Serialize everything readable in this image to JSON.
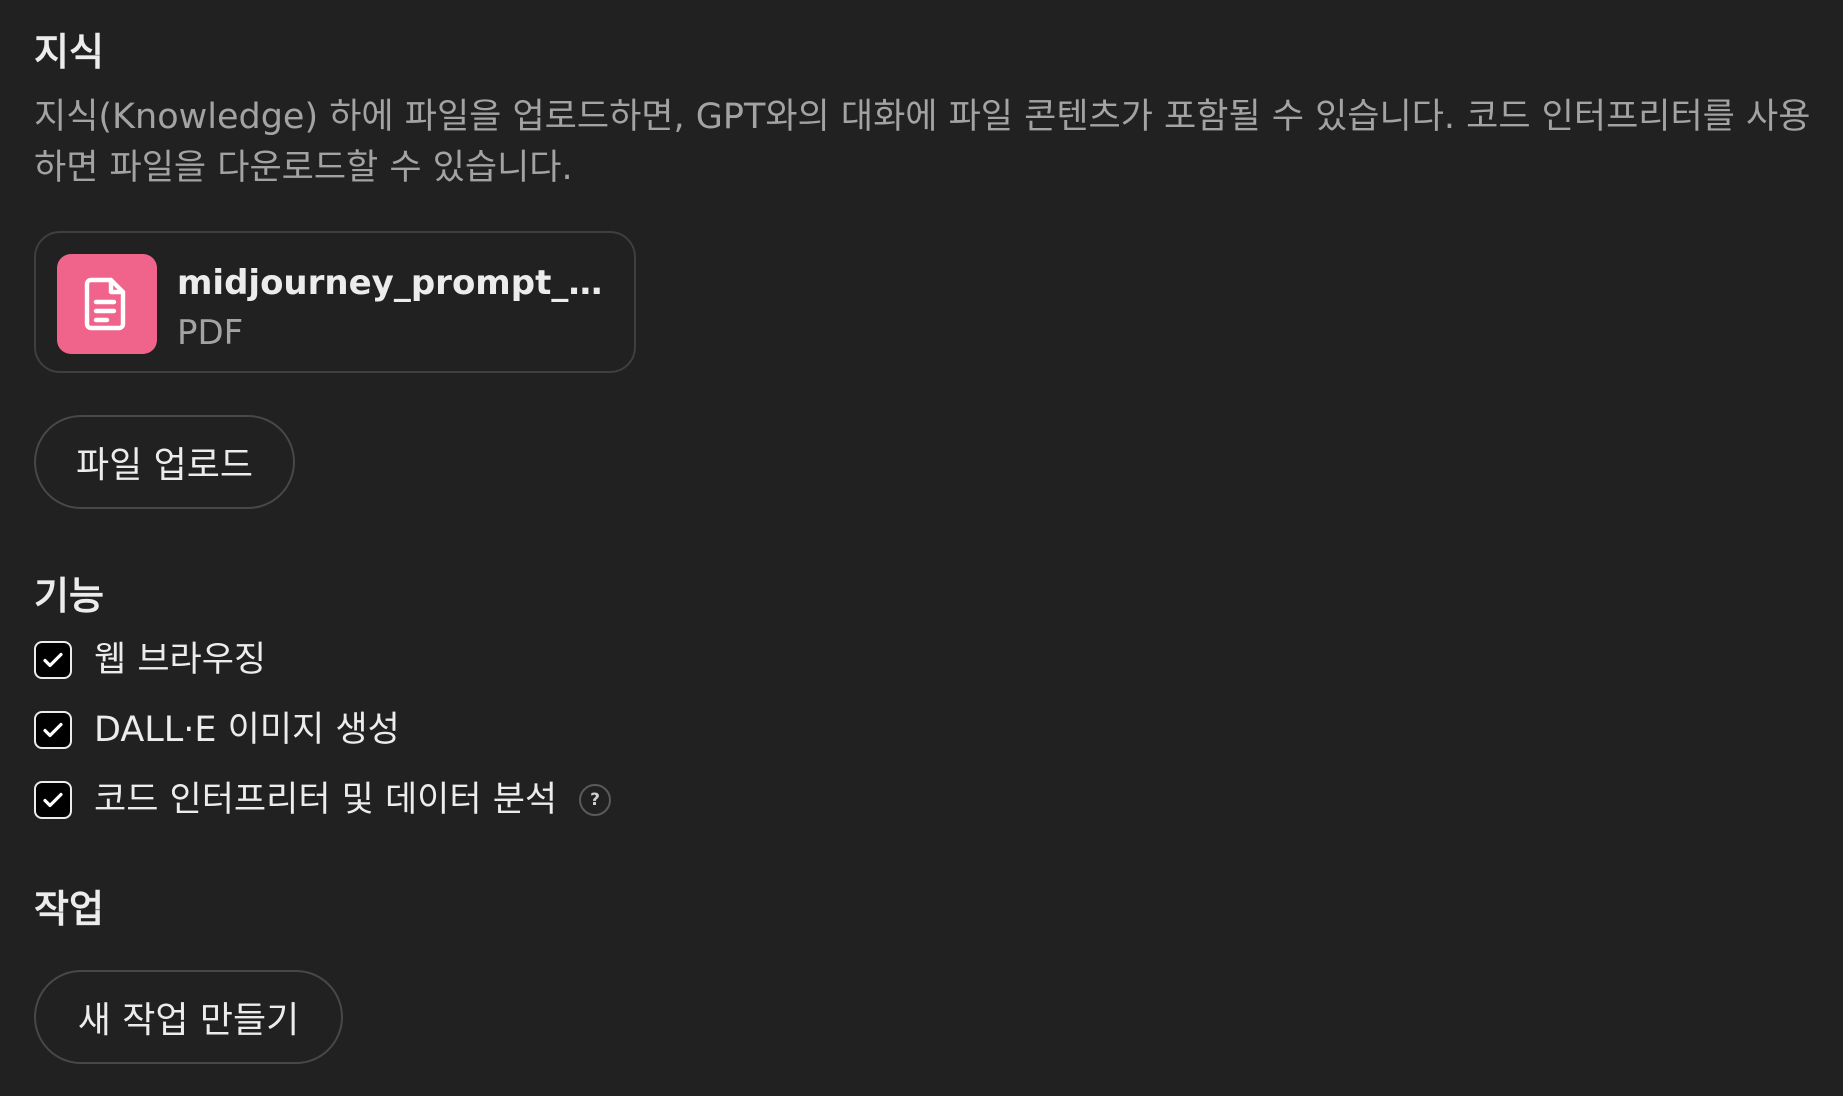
{
  "knowledge": {
    "title": "지식",
    "description": "지식(Knowledge) 하에 파일을 업로드하면, GPT와의 대화에 파일 콘텐츠가 포함될 수 있습니다. 코드 인터프리터를 사용하면 파일을 다운로드할 수 있습니다.",
    "files": [
      {
        "name": "midjourney_prompt_source.pdf",
        "type": "PDF",
        "icon": "document-icon",
        "icon_color": "#f0648c"
      }
    ],
    "upload_button_label": "파일 업로드"
  },
  "capabilities": {
    "title": "기능",
    "items": [
      {
        "label": "웹 브라우징",
        "checked": true
      },
      {
        "label": "DALL·E 이미지 생성",
        "checked": true
      },
      {
        "label": "코드 인터프리터 및 데이터 분석",
        "checked": true,
        "help_icon": "?"
      }
    ]
  },
  "actions": {
    "title": "작업",
    "create_button_label": "새 작업 만들기"
  }
}
